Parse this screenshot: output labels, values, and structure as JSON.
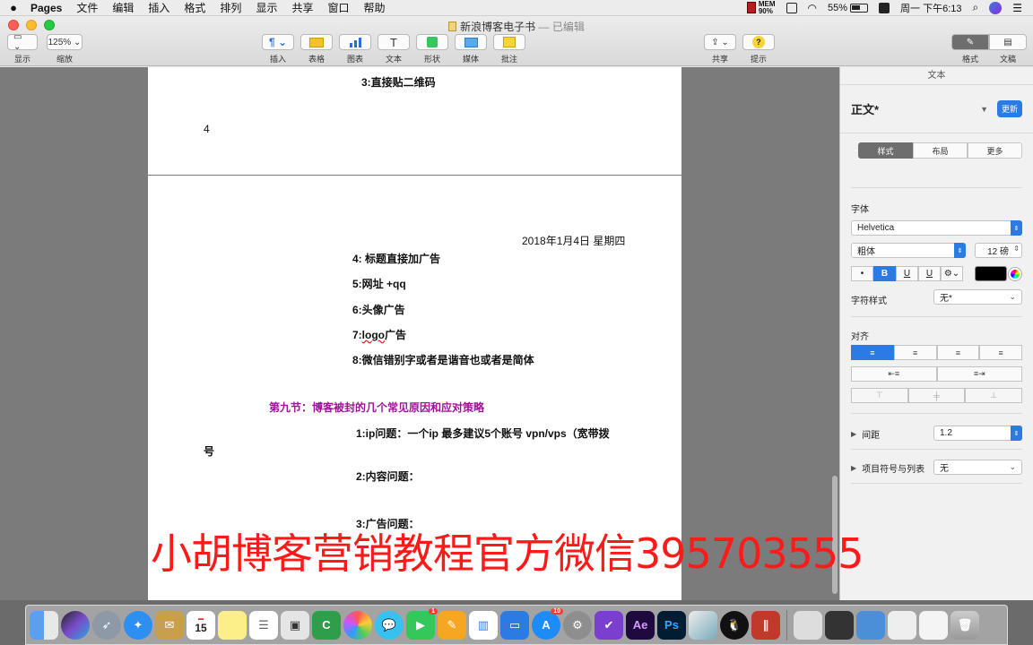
{
  "menubar": {
    "app_name": "Pages",
    "items": [
      "文件",
      "编辑",
      "插入",
      "格式",
      "排列",
      "显示",
      "共享",
      "窗口",
      "帮助"
    ],
    "mem_label": "MEM",
    "mem_value": "90%",
    "battery": "55%",
    "datetime": "周一 下午6:13"
  },
  "window": {
    "doc_title": "新浪博客电子书",
    "doc_status": "— 已编辑"
  },
  "toolbar": {
    "view": "显示",
    "zoom_value": "125%",
    "zoom": "缩放",
    "insert": "插入",
    "table": "表格",
    "chart": "图表",
    "text": "文本",
    "shape": "形状",
    "media": "媒体",
    "comment": "批注",
    "share": "共享",
    "tips": "提示",
    "format": "格式",
    "document": "文稿"
  },
  "page1": {
    "heading": "3:直接贴二维码",
    "number": "4"
  },
  "page2": {
    "date": "2018年1月4日 星期四",
    "line1": "4: 标题直接加广告",
    "line2": "5:网址 +qq",
    "line3": "6:头像广告",
    "line4_a": "7:",
    "line4_b": "logo",
    "line4_c": "广告",
    "line5": "8:微信错别字或者是谐音也或者是简体",
    "section": "第九节：博客被封的几个常见原因和应对策略",
    "item1": "1:ip问题：一个ip  最多建议5个账号    vpn/vps（宽带拨",
    "item1_wrap": "号",
    "item2": "2:内容问题：",
    "item3": "3:广告问题："
  },
  "watermark": "小胡博客营销教程官方微信395703555",
  "inspector": {
    "header": "文本",
    "style_name": "正文*",
    "update": "更新",
    "tabs": [
      "样式",
      "布局",
      "更多"
    ],
    "font_label": "字体",
    "font_family": "Helvetica",
    "font_weight": "粗体",
    "font_size": "12 磅",
    "format_buttons": [
      "•",
      "B",
      "U",
      "U"
    ],
    "char_style_label": "字符样式",
    "char_style_value": "无*",
    "align_label": "对齐",
    "spacing_label": "间距",
    "spacing_value": "1.2",
    "bullets_label": "项目符号与列表",
    "bullets_value": "无"
  },
  "dock": {
    "calendar_day": "15",
    "facetime_badge": "1",
    "appstore_badge": "10",
    "ae": "Ae",
    "ps": "Ps"
  }
}
